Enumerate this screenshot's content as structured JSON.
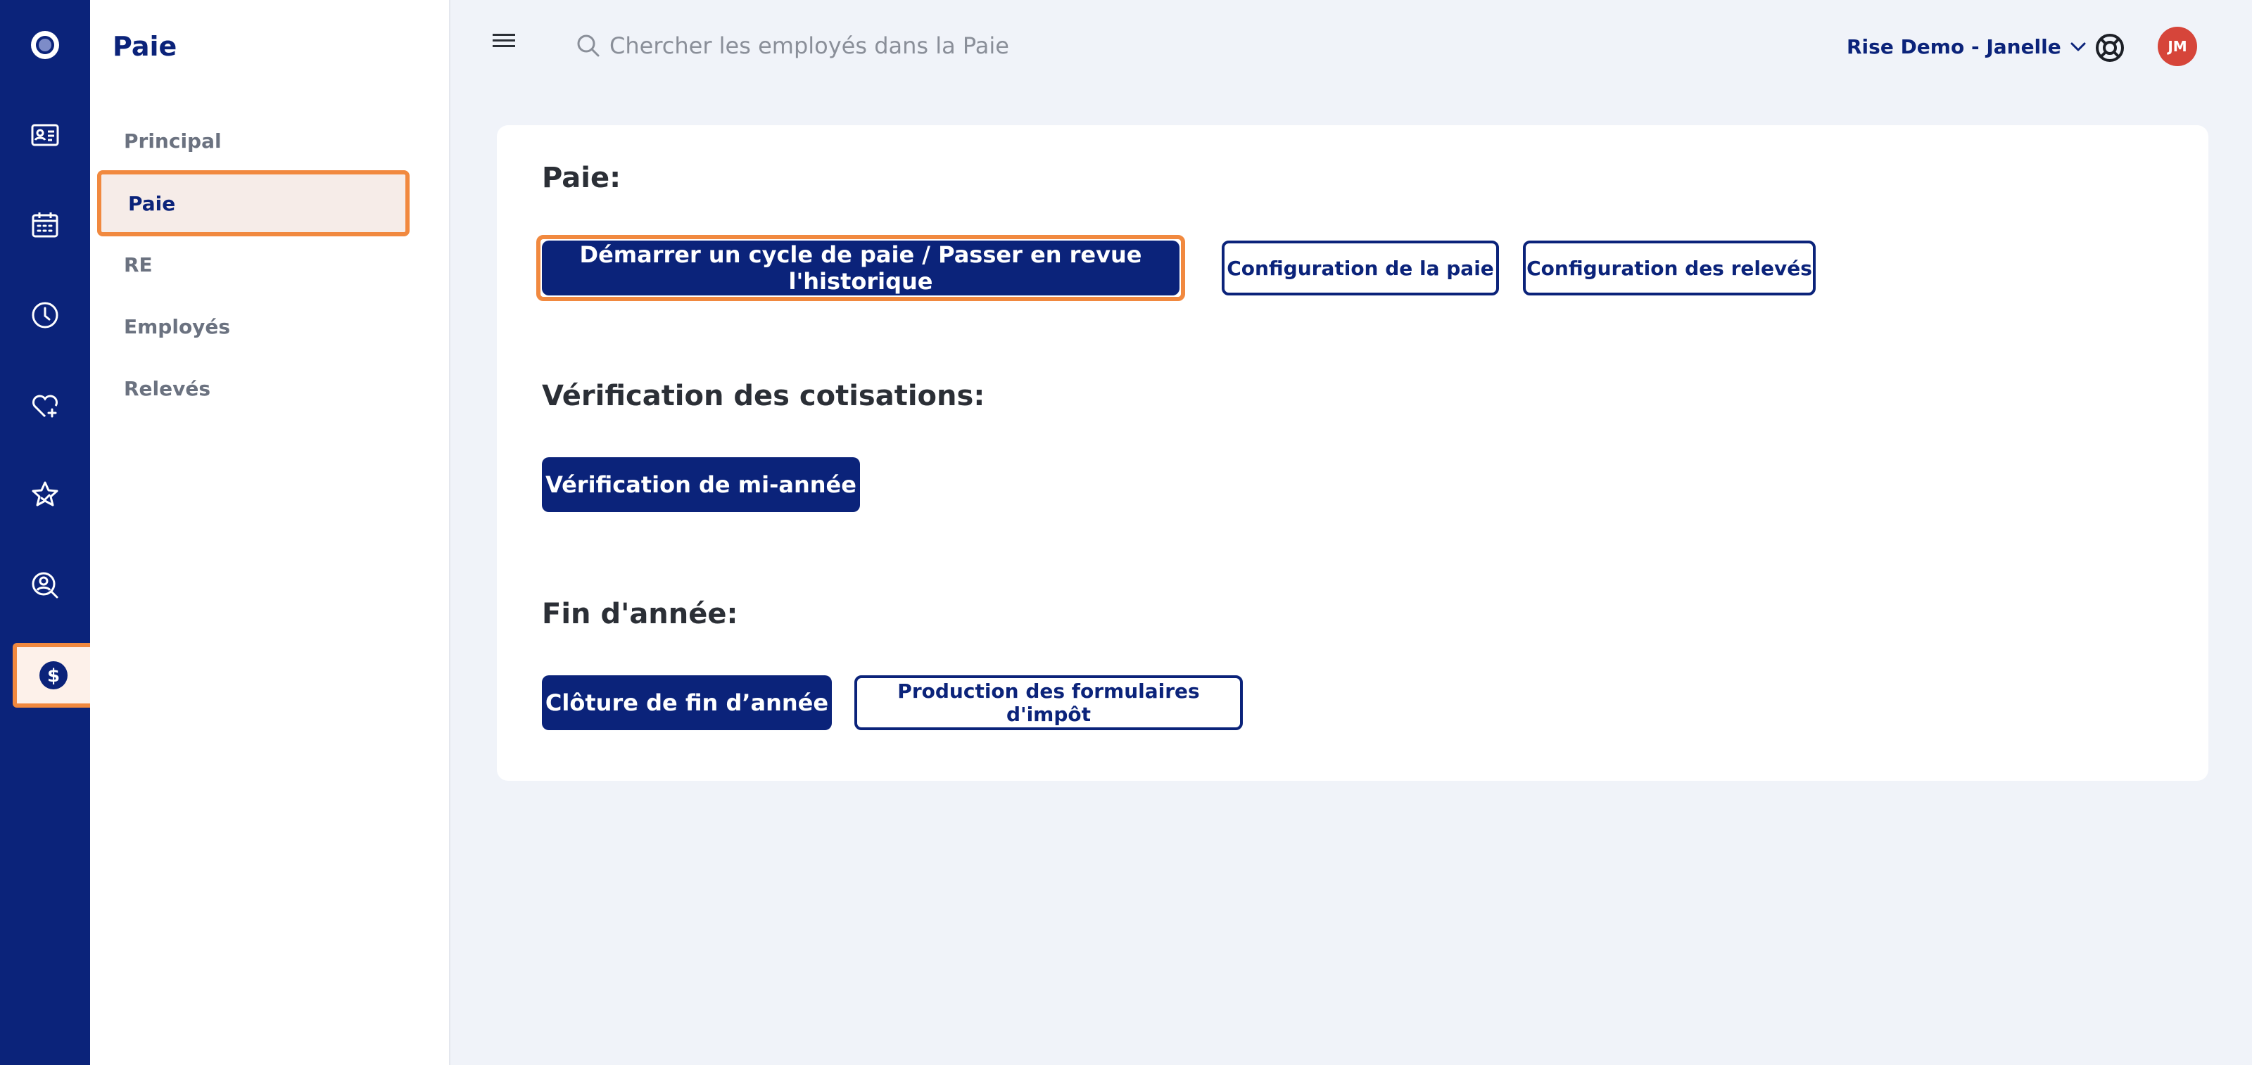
{
  "sidebar": {
    "title": "Paie",
    "items": [
      {
        "label": "Principal"
      },
      {
        "label": "Paie"
      },
      {
        "label": "RE"
      },
      {
        "label": "Employés"
      },
      {
        "label": "Relevés"
      }
    ]
  },
  "rail": {
    "icons": [
      "app-logo-icon",
      "id-card-icon",
      "calendar-icon",
      "clock-icon",
      "heart-plus-icon",
      "star-icon",
      "search-person-icon",
      "dollar-icon"
    ]
  },
  "header": {
    "search_placeholder": "Chercher les employés dans la Paie",
    "company": "Rise Demo - Janelle",
    "avatar_initials": "JM"
  },
  "main": {
    "sections": [
      {
        "title": "Paie:",
        "buttons": [
          {
            "label": "Démarrer un cycle de paie / Passer en revue l'historique"
          },
          {
            "label": "Configuration de la paie"
          },
          {
            "label": "Configuration des relevés"
          }
        ]
      },
      {
        "title": "Vérification des cotisations:",
        "buttons": [
          {
            "label": "Vérification de mi-année"
          }
        ]
      },
      {
        "title": "Fin d'année:",
        "buttons": [
          {
            "label": "Clôture de fin d’année"
          },
          {
            "label": "Production des formulaires d'impôt"
          }
        ]
      }
    ]
  },
  "colors": {
    "navy": "#0b237a",
    "highlight": "#f1893f",
    "avatar": "#d6453a",
    "background": "#f0f3f9"
  }
}
